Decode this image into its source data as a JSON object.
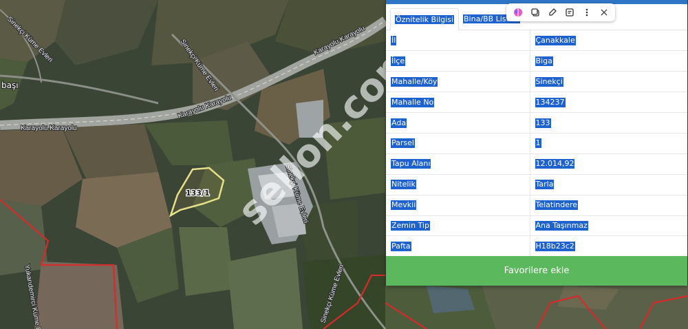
{
  "map": {
    "road_labels": [
      "Karayolu Karayolu",
      "Karayolu Karayolu",
      "Karayolu Karayolu",
      "Sinekçi Küme Evleri",
      "Sinekçi Küme Evleri",
      "Sinekçi Küme Evleri",
      "Yukarıdemirci Küme Evleri"
    ],
    "parcel_label": "133/1",
    "place_label": "başı",
    "watermark": "sellon.com"
  },
  "panel": {
    "tabs": [
      "Öznitelik Bilgisi",
      "Bina/BB Listesi"
    ],
    "active_tab": 0,
    "rows": [
      {
        "label": "İl",
        "value": "Çanakkale"
      },
      {
        "label": "İlçe",
        "value": "Biga"
      },
      {
        "label": "Mahalle/Köy",
        "value": "Sinekçi"
      },
      {
        "label": "Mahalle No",
        "value": "134237"
      },
      {
        "label": "Ada",
        "value": "133"
      },
      {
        "label": "Parsel",
        "value": "1"
      },
      {
        "label": "Tapu Alanı",
        "value": "12.014,92"
      },
      {
        "label": "Nitelik",
        "value": "Tarla"
      },
      {
        "label": "Mevkii",
        "value": "Telatindere"
      },
      {
        "label": "Zemin Tip",
        "value": "Ana Taşınmaz"
      },
      {
        "label": "Pafta",
        "value": "H18b23c2"
      }
    ],
    "favorite_button": "Favorilere ekle"
  },
  "toolbar": {
    "icons": [
      "brain-icon",
      "copy-icon",
      "pen-icon",
      "note-icon",
      "more-icon",
      "close-icon"
    ]
  },
  "colors": {
    "panel_top_bar": "#2e76c5",
    "selection": "#1e62cf",
    "favorite_button": "#5cb85c",
    "parcel_outline": "#e7e08a",
    "boundary_red": "#d42b2b"
  }
}
